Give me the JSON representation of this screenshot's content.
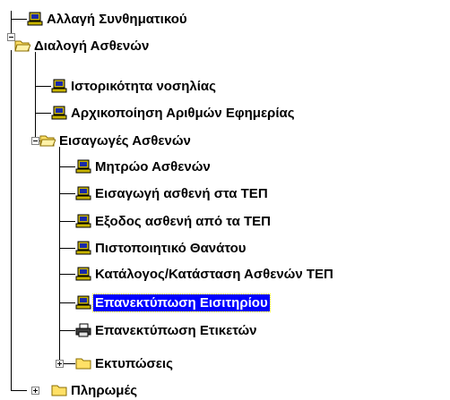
{
  "tree": {
    "change_password": "Αλλαγή Συνθηματικού",
    "patient_dialog": "Διαλογή Ασθενών",
    "hospitalization_history": "Ιστορικότητα νοσηλίας",
    "init_duty_numbers": "Αρχικοποίηση Αριθμών Εφημερίας",
    "patient_entries": "Εισαγωγές Ασθενών",
    "patient_registry": "Μητρώο Ασθενών",
    "patient_entry_tep": "Εισαγωγή ασθενή στα ΤΕΠ",
    "patient_exit_tep": "Εξοδος ασθενή από τα ΤΕΠ",
    "death_certificate": "Πιστοποιητικό Θανάτου",
    "patient_list_tep": "Κατάλογος/Κατάσταση Ασθενών ΤΕΠ",
    "reprint_ticket": "Επανεκτύπωση Εισιτηρίου",
    "reprint_labels": "Επανεκτύπωση Ετικετών",
    "printouts": "Εκτυπώσεις",
    "payments": "Πληρωμές"
  },
  "colors": {
    "selection": "#0000ff",
    "folder": "#ffe066",
    "computer": "#c8b400"
  }
}
